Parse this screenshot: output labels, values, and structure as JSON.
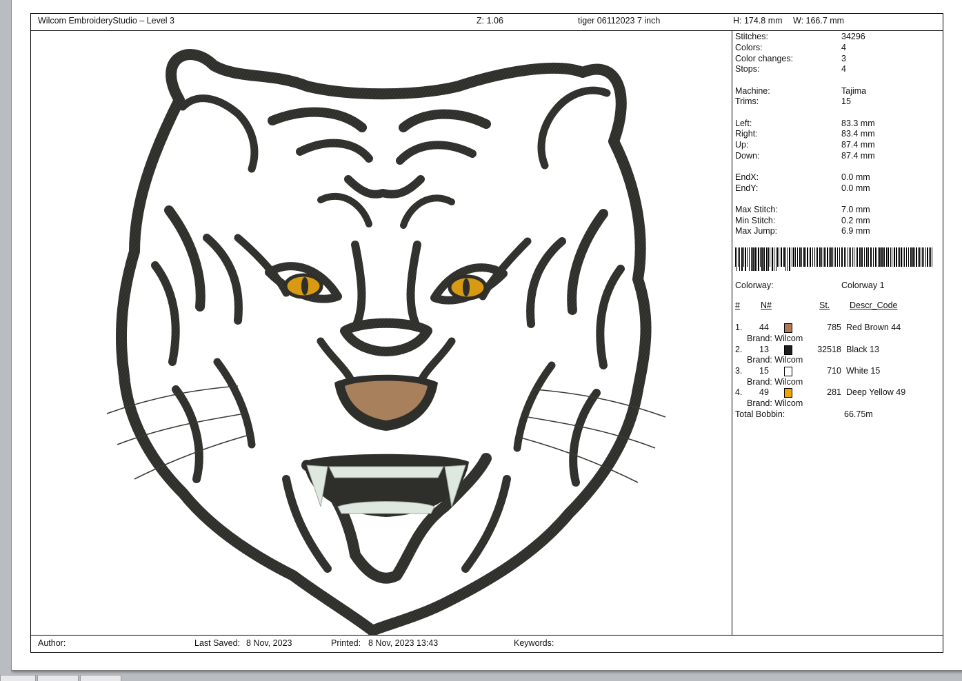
{
  "header": {
    "app_title": "Wilcom EmbroideryStudio – Level 3",
    "zoom": "Z: 1.06",
    "design_name": "tiger 06112023 7 inch",
    "height": "H: 174.8 mm",
    "width": "W: 166.7 mm"
  },
  "stats": [
    {
      "label": "Stitches:",
      "value": "34296"
    },
    {
      "label": "Colors:",
      "value": "4"
    },
    {
      "label": "Color changes:",
      "value": "3"
    },
    {
      "label": "Stops:",
      "value": "4"
    },
    {
      "label": "Machine:",
      "value": "Tajima"
    },
    {
      "label": "Trims:",
      "value": "15"
    },
    {
      "label": "Left:",
      "value": "83.3 mm"
    },
    {
      "label": "Right:",
      "value": "83.4 mm"
    },
    {
      "label": "Up:",
      "value": "87.4 mm"
    },
    {
      "label": "Down:",
      "value": "87.4 mm"
    },
    {
      "label": "EndX:",
      "value": "0.0 mm"
    },
    {
      "label": "EndY:",
      "value": "0.0 mm"
    },
    {
      "label": "Max Stitch:",
      "value": "7.0 mm"
    },
    {
      "label": "Min Stitch:",
      "value": "0.2 mm"
    },
    {
      "label": "Max Jump:",
      "value": "6.9 mm"
    }
  ],
  "colorway": {
    "label": "Colorway:",
    "value": "Colorway 1"
  },
  "color_table": {
    "headers": {
      "index": "#",
      "n": "N#",
      "st": "St.",
      "descr": "Descr_Code"
    },
    "rows": [
      {
        "index": "1.",
        "n": "44",
        "st": "785",
        "descr": "Red Brown 44",
        "brand": "Brand: Wilcom",
        "color": "#b07a5a"
      },
      {
        "index": "2.",
        "n": "13",
        "st": "32518",
        "descr": "Black 13",
        "brand": "Brand: Wilcom",
        "color": "#1e1e1e"
      },
      {
        "index": "3.",
        "n": "15",
        "st": "710",
        "descr": "White 15",
        "brand": "Brand: Wilcom",
        "color": "#ffffff"
      },
      {
        "index": "4.",
        "n": "49",
        "st": "281",
        "descr": "Deep Yellow 49",
        "brand": "Brand: Wilcom",
        "color": "#f0a400"
      }
    ],
    "total_bobbin_label": "Total Bobbin:",
    "total_bobbin_value": "66.75m"
  },
  "footer": {
    "author": "Author:",
    "last_saved_label": "Last Saved:",
    "last_saved_value": "8 Nov, 2023",
    "printed_label": "Printed:",
    "printed_value": "8 Nov, 2023 13:43",
    "keywords": "Keywords:"
  },
  "design_colors": {
    "stitch_dark": "#2e2e2b",
    "mouth": "#a8805c",
    "eyes": "#d89a12",
    "teeth": "#dfe8df"
  }
}
